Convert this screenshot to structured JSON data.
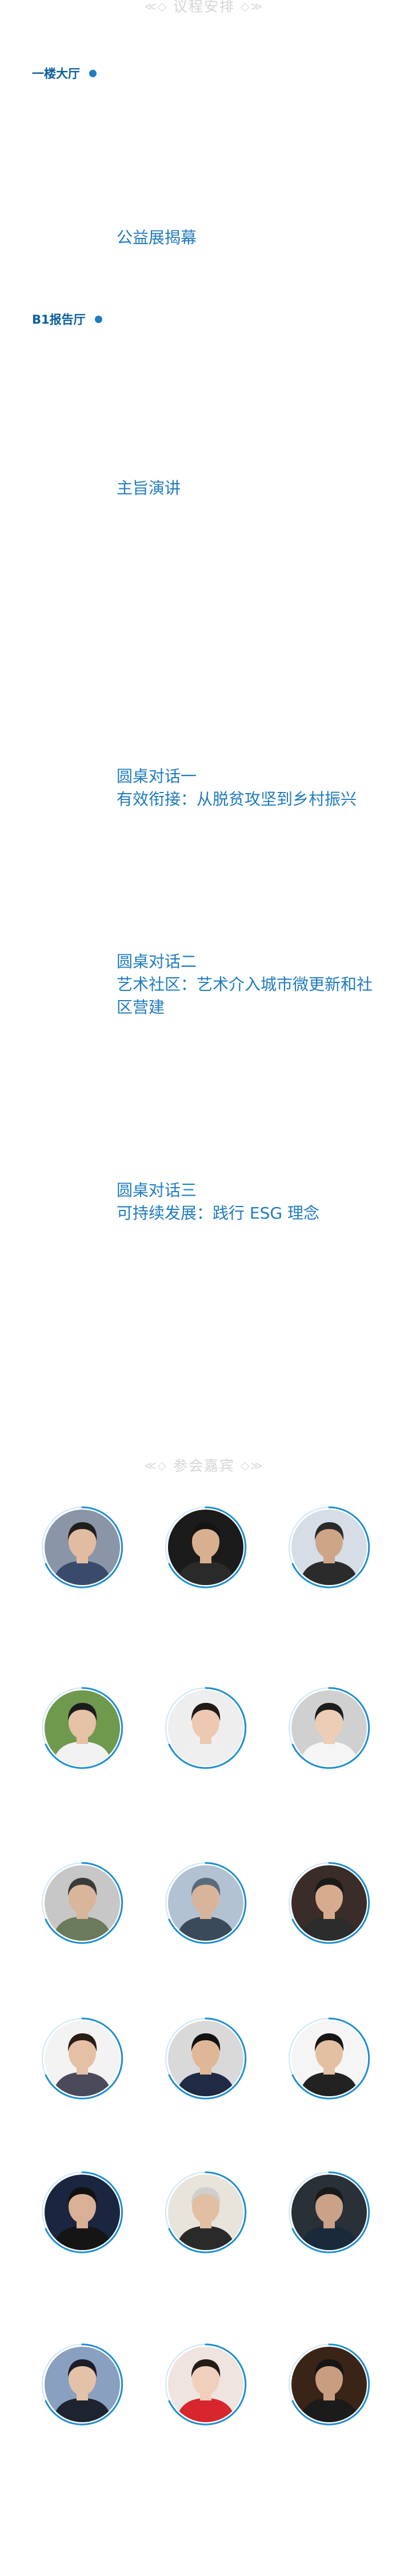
{
  "agenda": {
    "title": "议程安排",
    "venues": [
      {
        "label": "一楼大厅"
      },
      {
        "label": "B1报告厅"
      }
    ],
    "sessions": [
      {
        "lines": [
          "公益展揭幕"
        ]
      },
      {
        "lines": [
          "主旨演讲"
        ]
      },
      {
        "lines": [
          "圆桌对话一",
          "有效衔接：从脱贫攻坚到乡村振兴"
        ]
      },
      {
        "lines": [
          "圆桌对话二",
          "艺术社区：艺术介入城市微更新和社",
          "区营建"
        ]
      },
      {
        "lines": [
          "圆桌对话三",
          "可持续发展：践行 ESG 理念"
        ]
      }
    ]
  },
  "guests": {
    "title": "参会嘉宾",
    "ring_color": "#1e8fd0",
    "portraits": [
      {
        "bg": "#8a96a8",
        "skin": "#e2bca0",
        "hair": "#1f1f1f",
        "cloth": "#3a4a6a"
      },
      {
        "bg": "#1b1b1b",
        "skin": "#d8b090",
        "hair": "#141414",
        "cloth": "#2a2a2a"
      },
      {
        "bg": "#d6dde6",
        "skin": "#cfa588",
        "hair": "#2a2a2a",
        "cloth": "#2b2b2b"
      },
      {
        "bg": "#6f9a4e",
        "skin": "#e6c2a6",
        "hair": "#1c1c1c",
        "cloth": "#f2f2f2"
      },
      {
        "bg": "#eeeeee",
        "skin": "#ecc9b0",
        "hair": "#221a15",
        "cloth": "#efefef"
      },
      {
        "bg": "#d0d0d0",
        "skin": "#eccdb6",
        "hair": "#1c1c1c",
        "cloth": "#f5f5f5"
      },
      {
        "bg": "#c7c7c7",
        "skin": "#d9b59c",
        "hair": "#3a3a3a",
        "cloth": "#6a7a5a"
      },
      {
        "bg": "#b3c2d2",
        "skin": "#d8b49a",
        "hair": "#5a6a7a",
        "cloth": "#3a4a5a"
      },
      {
        "bg": "#3a2c28",
        "skin": "#d7ab8e",
        "hair": "#1a1a1a",
        "cloth": "#2c2c2c"
      },
      {
        "bg": "#f3f3f3",
        "skin": "#e6c0a4",
        "hair": "#2a1d16",
        "cloth": "#4a4a5a"
      },
      {
        "bg": "#d9d9d9",
        "skin": "#e0b796",
        "hair": "#121212",
        "cloth": "#1f2a44"
      },
      {
        "bg": "#f5f5f5",
        "skin": "#e4c0a2",
        "hair": "#161616",
        "cloth": "#222222"
      },
      {
        "bg": "#1a2540",
        "skin": "#d9b096",
        "hair": "#111111",
        "cloth": "#151515"
      },
      {
        "bg": "#e8e4dc",
        "skin": "#e2bea2",
        "hair": "#cfcfcf",
        "cloth": "#2a2a2a"
      },
      {
        "bg": "#2a3038",
        "skin": "#c9a288",
        "hair": "#1a1a1a",
        "cloth": "#1a2a3a"
      },
      {
        "bg": "#8aa0c0",
        "skin": "#e4c2a8",
        "hair": "#1d1d2a",
        "cloth": "#1e2330"
      },
      {
        "bg": "#f0e4e0",
        "skin": "#f0d0bc",
        "hair": "#241a16",
        "cloth": "#d8262e"
      },
      {
        "bg": "#3a2418",
        "skin": "#c99e80",
        "hair": "#151515",
        "cloth": "#1b1b1b"
      }
    ]
  }
}
